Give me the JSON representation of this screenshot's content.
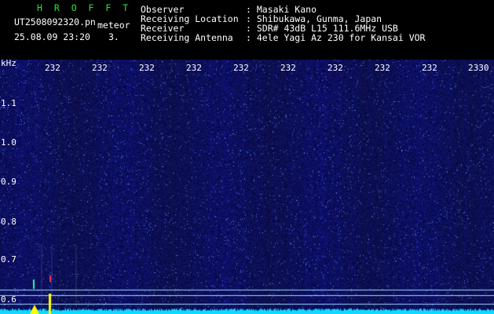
{
  "header": {
    "app_name": "H R O F F T",
    "filename": "UT2508092320.pn",
    "tag": "meteor",
    "datetime": "25.08.09 23:20",
    "count": "3.",
    "fields": [
      {
        "label": "Observer",
        "value": ": Masaki Kano"
      },
      {
        "label": "Receiving Location",
        "value": ": Shibukawa, Gunma, Japan"
      },
      {
        "label": "Receiver",
        "value": ": SDR# 43dB L15 111.6MHz USB"
      },
      {
        "label": "Receiving Antenna",
        "value": ": 4ele Yagi Az 230 for Kansai VOR"
      }
    ]
  },
  "axes": {
    "y_unit": "kHz",
    "y_ticks": [
      "1.1",
      "1.0",
      "0.9",
      "0.8",
      "0.7",
      "0.6"
    ],
    "x_ticks": [
      "232",
      "232",
      "232",
      "232",
      "232",
      "232",
      "232",
      "232",
      "232",
      "2330"
    ]
  },
  "colors": {
    "background": "#000000",
    "spectrogram_base": "#0a0f6e",
    "noise_floor": "#12d8ff",
    "header_accent": "#26e43a",
    "meteor_head": "#ffff00"
  }
}
